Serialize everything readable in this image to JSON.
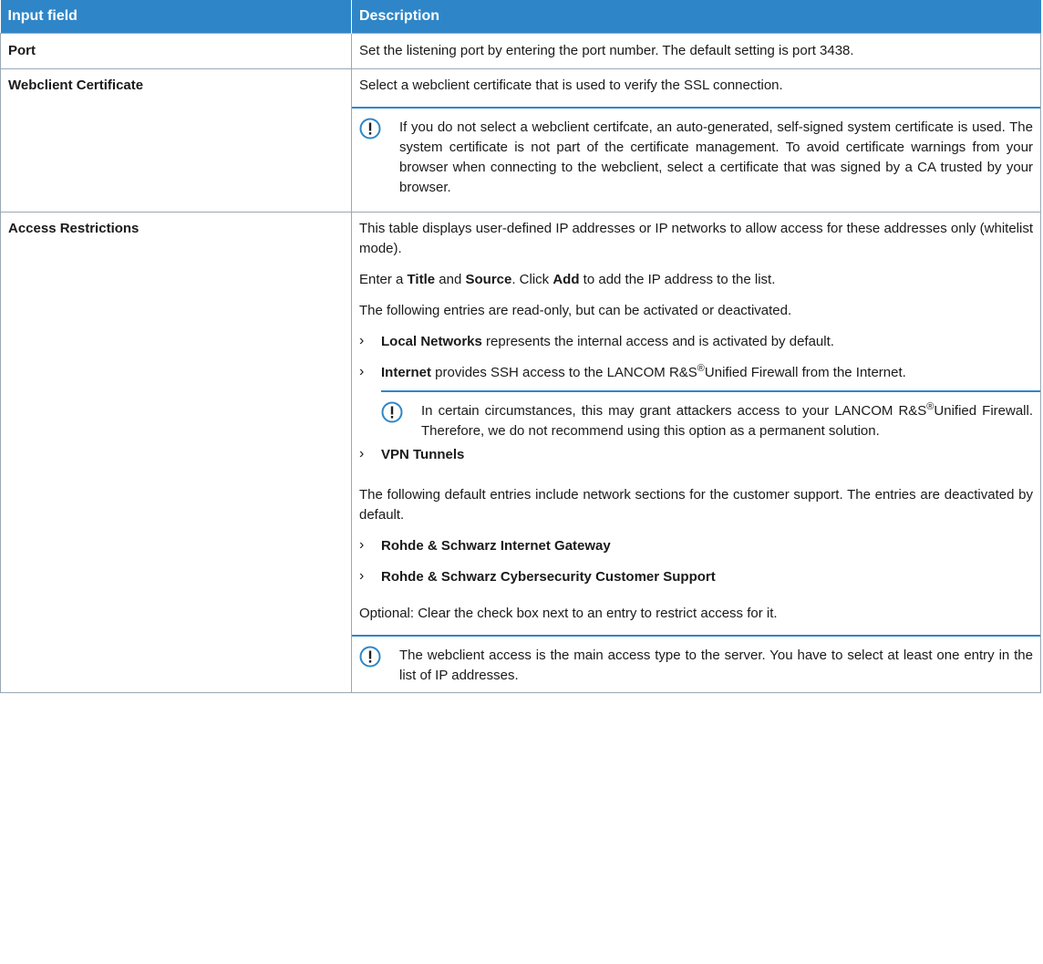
{
  "table": {
    "header": {
      "col1": "Input field",
      "col2": "Description"
    },
    "port": {
      "field": "Port",
      "desc": "Set the listening port by entering the port number. The default setting is port 3438."
    },
    "webclient": {
      "field": "Webclient Certificate",
      "desc": "Select a webclient certificate that is used to verify the SSL connection.",
      "note": "If you do not select a webclient certifcate, an auto-generated, self-signed system certificate is used. The system certificate is not part of the certificate management. To avoid certificate warnings from your browser when connecting to the webclient, select a certificate that was signed by a CA trusted by your browser."
    },
    "access": {
      "field": "Access Restrictions",
      "intro": "This table displays user-defined IP addresses or IP networks to allow access for these addresses only (whitelist mode).",
      "enter_1": "Enter a ",
      "enter_title": "Title",
      "enter_2": " and ",
      "enter_source": "Source",
      "enter_3": ". Click ",
      "enter_add": "Add",
      "enter_4": " to add the IP address to the list.",
      "readonly": "The following entries are read-only, but can be activated or deactivated.",
      "local_bold": "Local Networks",
      "local_text": " represents the internal access and is activated by default.",
      "internet_bold": "Internet",
      "internet_text_1": " provides SSH access to the LANCOM R&S",
      "internet_sup": "®",
      "internet_text_2": "Unified Firewall from the Internet.",
      "internet_note_1": "In certain circumstances, this may grant attackers access to your LANCOM R&S",
      "internet_note_sup": "®",
      "internet_note_2": "Unified Firewall. Therefore, we do not recommend using this option as a permanent solution.",
      "vpn_bold": "VPN Tunnels",
      "default_entries": "The following default entries include network sections for the customer support. The entries are deactivated by default.",
      "rs_gateway": "Rohde & Schwarz Internet Gateway",
      "rs_support": "Rohde & Schwarz Cybersecurity Customer Support",
      "optional": "Optional: Clear the check box next to an entry to restrict access for it.",
      "final_note": "The webclient access is the main access type to the server. You have to select at least one entry in the list of IP addresses."
    }
  },
  "colors": {
    "accent": "#2e86c8",
    "border": "#9aa8b3"
  },
  "icons": {
    "note": "exclamation-circle-icon",
    "bullet": "chevron-right-icon"
  }
}
